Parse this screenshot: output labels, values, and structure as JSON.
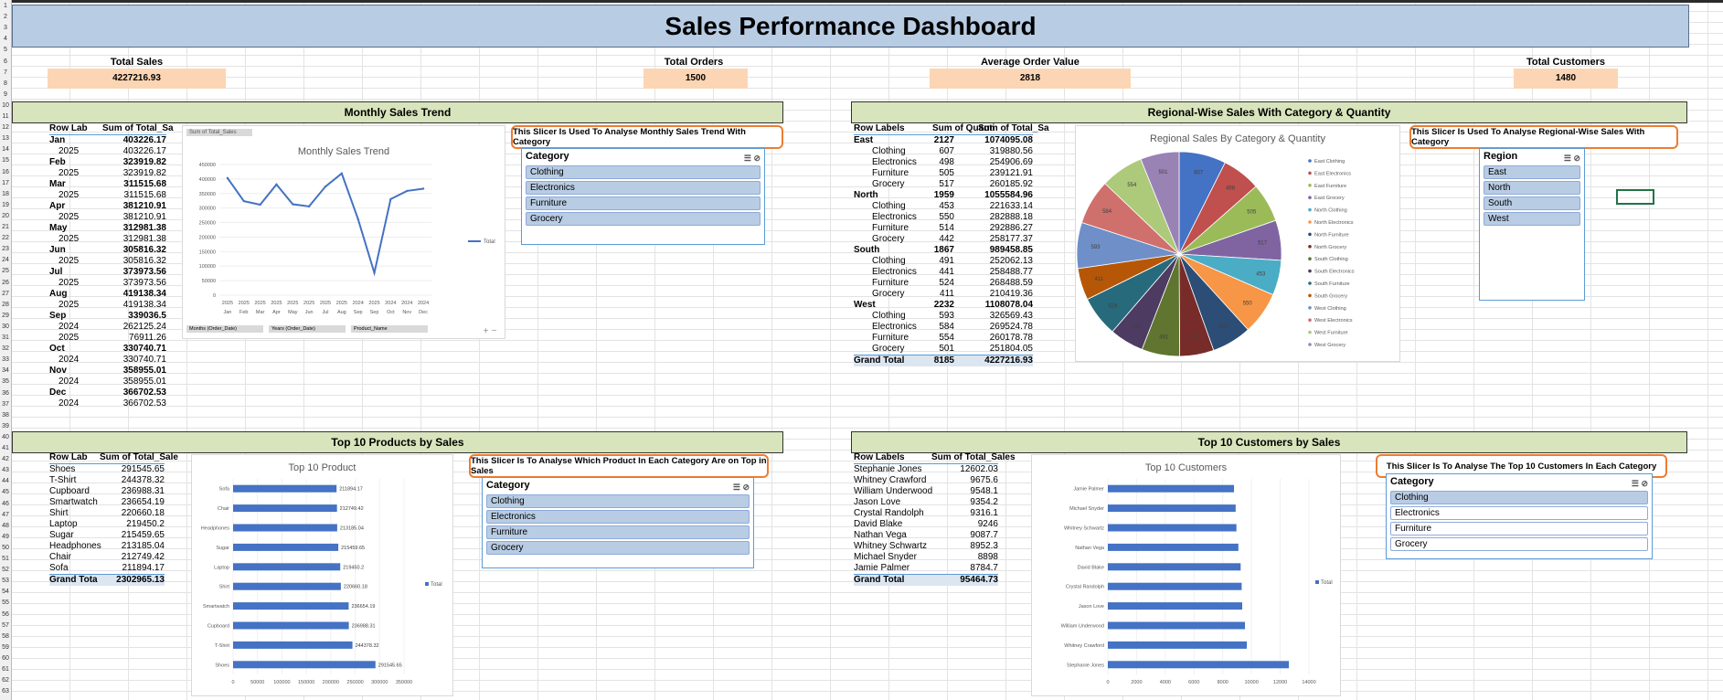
{
  "title": "Sales Performance Dashboard",
  "kpis": {
    "total_sales_label": "Total Sales",
    "total_sales": "4227216.93",
    "total_orders_label": "Total Orders",
    "total_orders": "1500",
    "aov_label": "Average Order Value",
    "aov": "2818",
    "customers_label": "Total Customers",
    "customers": "1480"
  },
  "sections": {
    "monthly": "Monthly Sales Trend",
    "regional": "Regional-Wise Sales With Category & Quantity",
    "products": "Top 10 Products by Sales",
    "customers": "Top 10 Customers by Sales"
  },
  "notes": {
    "monthly": "This Slicer Is Used To Analyse Monthly Sales Trend With Category",
    "regional": "This Slicer Is Used To Analyse Regional-Wise Sales With Category",
    "products": "This Slicer Is To Analyse Which Product In Each Category Are on Top in Sales",
    "customers": "This Slicer Is To Analyse The Top 10 Customers In Each Category"
  },
  "slicers": {
    "category_title": "Category",
    "region_title": "Region",
    "categories": [
      "Clothing",
      "Electronics",
      "Furniture",
      "Grocery"
    ],
    "regions": [
      "East",
      "North",
      "South",
      "West"
    ]
  },
  "monthly_pivot": {
    "h1": "Row Lab",
    "h2": "Sum of Total_Sa",
    "rows": [
      {
        "l": "Jan",
        "v": "403226.17",
        "b": true
      },
      {
        "l": "2025",
        "v": "403226.17"
      },
      {
        "l": "Feb",
        "v": "323919.82",
        "b": true
      },
      {
        "l": "2025",
        "v": "323919.82"
      },
      {
        "l": "Mar",
        "v": "311515.68",
        "b": true
      },
      {
        "l": "2025",
        "v": "311515.68"
      },
      {
        "l": "Apr",
        "v": "381210.91",
        "b": true
      },
      {
        "l": "2025",
        "v": "381210.91"
      },
      {
        "l": "May",
        "v": "312981.38",
        "b": true
      },
      {
        "l": "2025",
        "v": "312981.38"
      },
      {
        "l": "Jun",
        "v": "305816.32",
        "b": true
      },
      {
        "l": "2025",
        "v": "305816.32"
      },
      {
        "l": "Jul",
        "v": "373973.56",
        "b": true
      },
      {
        "l": "2025",
        "v": "373973.56"
      },
      {
        "l": "Aug",
        "v": "419138.34",
        "b": true
      },
      {
        "l": "2025",
        "v": "419138.34"
      },
      {
        "l": "Sep",
        "v": "339036.5",
        "b": true
      },
      {
        "l": "2024",
        "v": "262125.24"
      },
      {
        "l": "2025",
        "v": "76911.26"
      },
      {
        "l": "Oct",
        "v": "330740.71",
        "b": true
      },
      {
        "l": "2024",
        "v": "330740.71"
      },
      {
        "l": "Nov",
        "v": "358955.01",
        "b": true
      },
      {
        "l": "2024",
        "v": "358955.01"
      },
      {
        "l": "Dec",
        "v": "366702.53",
        "b": true
      },
      {
        "l": "2024",
        "v": "366702.53"
      }
    ]
  },
  "regional_pivot": {
    "h1": "Row Labels",
    "h2": "Sum of Quanti",
    "h3": "Sum of Total_Sa",
    "rows": [
      {
        "l": "East",
        "q": "2127",
        "v": "1074095.08",
        "b": true
      },
      {
        "l": "Clothing",
        "q": "607",
        "v": "319880.56"
      },
      {
        "l": "Electronics",
        "q": "498",
        "v": "254906.69"
      },
      {
        "l": "Furniture",
        "q": "505",
        "v": "239121.91"
      },
      {
        "l": "Grocery",
        "q": "517",
        "v": "260185.92"
      },
      {
        "l": "North",
        "q": "1959",
        "v": "1055584.96",
        "b": true
      },
      {
        "l": "Clothing",
        "q": "453",
        "v": "221633.14"
      },
      {
        "l": "Electronics",
        "q": "550",
        "v": "282888.18"
      },
      {
        "l": "Furniture",
        "q": "514",
        "v": "292886.27"
      },
      {
        "l": "Grocery",
        "q": "442",
        "v": "258177.37"
      },
      {
        "l": "South",
        "q": "1867",
        "v": "989458.85",
        "b": true
      },
      {
        "l": "Clothing",
        "q": "491",
        "v": "252062.13"
      },
      {
        "l": "Electronics",
        "q": "441",
        "v": "258488.77"
      },
      {
        "l": "Furniture",
        "q": "524",
        "v": "268488.59"
      },
      {
        "l": "Grocery",
        "q": "411",
        "v": "210419.36"
      },
      {
        "l": "West",
        "q": "2232",
        "v": "1108078.04",
        "b": true
      },
      {
        "l": "Clothing",
        "q": "593",
        "v": "326569.43"
      },
      {
        "l": "Electronics",
        "q": "584",
        "v": "269524.78"
      },
      {
        "l": "Furniture",
        "q": "554",
        "v": "260178.78"
      },
      {
        "l": "Grocery",
        "q": "501",
        "v": "251804.05"
      }
    ],
    "total_label": "Grand Total",
    "total_q": "8185",
    "total_v": "4227216.93"
  },
  "products_pivot": {
    "h1": "Row Lab",
    "h2": "Sum of Total_Sale",
    "rows": [
      {
        "l": "Shoes",
        "v": "291545.65"
      },
      {
        "l": "T-Shirt",
        "v": "244378.32"
      },
      {
        "l": "Cupboard",
        "v": "236988.31"
      },
      {
        "l": "Smartwatch",
        "v": "236654.19"
      },
      {
        "l": "Shirt",
        "v": "220660.18"
      },
      {
        "l": "Laptop",
        "v": "219450.2"
      },
      {
        "l": "Sugar",
        "v": "215459.65"
      },
      {
        "l": "Headphones",
        "v": "213185.04"
      },
      {
        "l": "Chair",
        "v": "212749.42"
      },
      {
        "l": "Sofa",
        "v": "211894.17"
      }
    ],
    "total_label": "Grand Tota",
    "total_v": "2302965.13"
  },
  "customers_pivot": {
    "h1": "Row Labels",
    "h2": "Sum of Total_Sales",
    "rows": [
      {
        "l": "Stephanie Jones",
        "v": "12602.03"
      },
      {
        "l": "Whitney Crawford",
        "v": "9675.6"
      },
      {
        "l": "William Underwood",
        "v": "9548.1"
      },
      {
        "l": "Jason Love",
        "v": "9354.2"
      },
      {
        "l": "Crystal Randolph",
        "v": "9316.1"
      },
      {
        "l": "David Blake",
        "v": "9246"
      },
      {
        "l": "Nathan Vega",
        "v": "9087.7"
      },
      {
        "l": "Whitney Schwartz",
        "v": "8952.3"
      },
      {
        "l": "Michael Snyder",
        "v": "8898"
      },
      {
        "l": "Jamie Palmer",
        "v": "8784.7"
      }
    ],
    "total_label": "Grand Total",
    "total_v": "95464.73"
  },
  "chart_data": [
    {
      "type": "line",
      "title": "Monthly Sales Trend",
      "tag": "Sum of Total_Sales",
      "categories": [
        "Jan",
        "Feb",
        "Mar",
        "Apr",
        "May",
        "Jun",
        "Jul",
        "Aug",
        "Sep",
        "Sep",
        "Oct",
        "Nov",
        "Dec"
      ],
      "year_labels": [
        "2025",
        "2025",
        "2025",
        "2025",
        "2025",
        "2025",
        "2025",
        "2025",
        "2024",
        "2025",
        "2024",
        "2024",
        "2024"
      ],
      "series": [
        {
          "name": "Total",
          "values": [
            403226.17,
            323919.82,
            311515.68,
            381210.91,
            312981.38,
            305816.32,
            373973.56,
            419138.34,
            262125.24,
            76911.26,
            330740.71,
            358955.01,
            366702.53
          ]
        }
      ],
      "ylim": [
        0,
        450000
      ],
      "yticks": [
        "0",
        "50000",
        "100000",
        "150000",
        "200000",
        "250000",
        "300000",
        "350000",
        "400000",
        "450000"
      ],
      "field_buttons": [
        "Months (Order_Date)",
        "Years (Order_Date)",
        "Product_Name"
      ],
      "color": "#4472c4"
    },
    {
      "type": "pie",
      "title": "Regional Sales By Category & Quantity",
      "labels": [
        "East Clothing",
        "East Electronics",
        "East Furniture",
        "East Grocery",
        "North Clothing",
        "North Electronics",
        "North Furniture",
        "North Grocery",
        "South Clothing",
        "South Electronics",
        "South Furniture",
        "South Grocery",
        "West Clothing",
        "West Electronics",
        "West Furniture",
        "West Grocery"
      ],
      "values": [
        607,
        498,
        505,
        517,
        453,
        550,
        514,
        442,
        491,
        441,
        524,
        411,
        593,
        584,
        554,
        501
      ],
      "colors": [
        "#4472c4",
        "#c0504d",
        "#9bbb59",
        "#8064a2",
        "#4bacc6",
        "#f79646",
        "#2c4d75",
        "#772c2a",
        "#5f7530",
        "#4d3b62",
        "#276a7c",
        "#b65708",
        "#6f8fc9",
        "#d0706d",
        "#adc97a",
        "#9983b5"
      ]
    },
    {
      "type": "bar",
      "title": "Top 10 Product",
      "categories": [
        "Sofa",
        "Chair",
        "Headphones",
        "Sugar",
        "Laptop",
        "Shirt",
        "Smartwatch",
        "Cupboard",
        "T-Shirt",
        "Shoes"
      ],
      "series": [
        {
          "name": "Total",
          "values": [
            211894.17,
            212749.42,
            213185.04,
            215459.65,
            219450.2,
            220660.18,
            236654.19,
            236988.31,
            244378.32,
            291545.65
          ]
        }
      ],
      "xlim": [
        0,
        350000
      ],
      "xticks": [
        "0",
        "50000",
        "100000",
        "150000",
        "200000",
        "250000",
        "300000",
        "350000"
      ],
      "color": "#4472c4"
    },
    {
      "type": "bar",
      "title": "Top 10 Customers",
      "categories": [
        "Jamie Palmer",
        "Michael Snyder",
        "Whitney Schwartz",
        "Nathan Vega",
        "David Blake",
        "Crystal Randolph",
        "Jason Love",
        "William Underwood",
        "Whitney Crawford",
        "Stephanie Jones"
      ],
      "series": [
        {
          "name": "Total",
          "values": [
            8784.7,
            8898,
            8952.3,
            9087.7,
            9246,
            9316.1,
            9354.2,
            9548.1,
            9675.6,
            12602.03
          ]
        }
      ],
      "xlim": [
        0,
        14000
      ],
      "xticks": [
        "0",
        "2000",
        "4000",
        "6000",
        "8000",
        "10000",
        "12000",
        "14000"
      ],
      "color": "#4472c4"
    }
  ]
}
